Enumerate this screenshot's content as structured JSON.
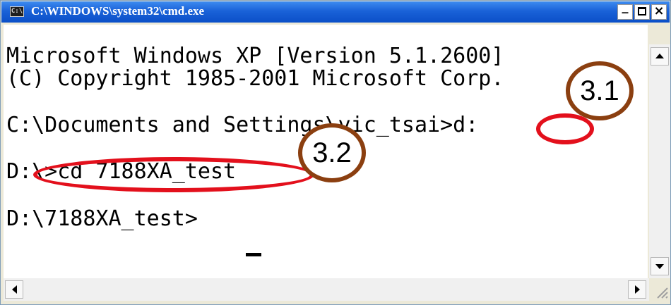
{
  "window": {
    "title": "C:\\WINDOWS\\system32\\cmd.exe",
    "icon_text": "C:\\",
    "minimize_label": "_",
    "maximize_label": "",
    "close_label": "×"
  },
  "console": {
    "lines": [
      "Microsoft Windows XP [Version 5.1.2600]",
      "(C) Copyright 1985-2001 Microsoft Corp.",
      "",
      "C:\\Documents and Settings\\vic_tsai>d:",
      "",
      "D:\\>cd 7188XA_test",
      "",
      "D:\\7188XA_test>"
    ]
  },
  "annotations": {
    "callout_1": "3.1",
    "callout_2": "3.2",
    "highlight_color": "#e3101c",
    "callout_border_color": "#8b3f10"
  },
  "icons": {
    "window_icon": "cmd-icon",
    "scroll_up": "arrow-up-icon",
    "scroll_down": "arrow-down-icon",
    "scroll_left": "arrow-left-icon",
    "scroll_right": "arrow-right-icon",
    "resize_grip": "resize-grip-icon"
  }
}
